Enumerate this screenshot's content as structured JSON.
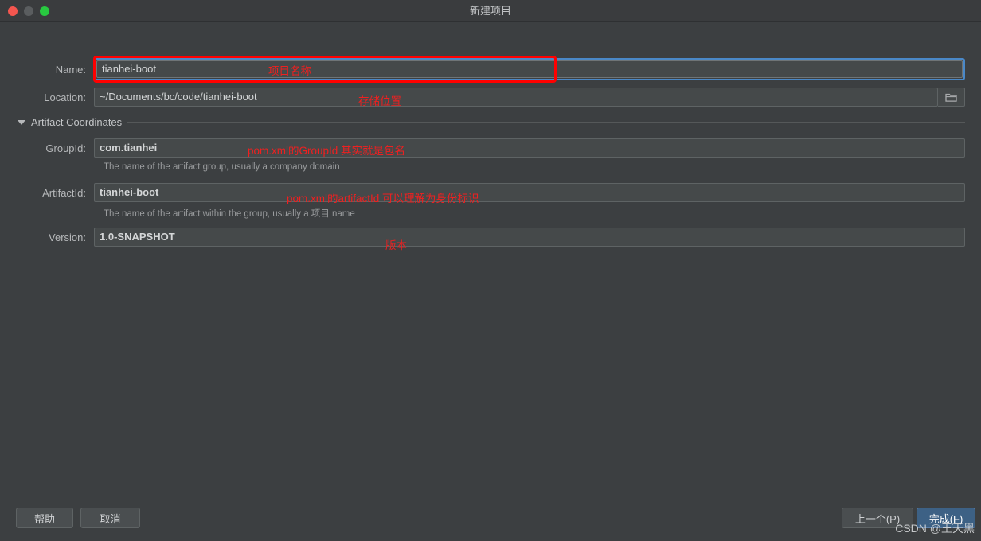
{
  "window": {
    "title": "新建项目",
    "traffic_lights": [
      "close",
      "minimize",
      "zoom"
    ]
  },
  "form": {
    "name": {
      "label": "Name:",
      "value": "tianhei-boot",
      "focused": true,
      "highlight_color": "#ff0000",
      "focus_color": "#4a88c7"
    },
    "location": {
      "label": "Location:",
      "value": "~/Documents/bc/code/tianhei-boot",
      "browse_icon": "folder-icon"
    },
    "artifact_section": {
      "label": "Artifact Coordinates",
      "expanded": true,
      "disclosure_icon": "triangle-down-icon"
    },
    "group_id": {
      "label": "GroupId:",
      "value": "com.tianhei",
      "hint": "The name of the artifact group, usually a company domain"
    },
    "artifact_id": {
      "label": "ArtifactId:",
      "value": "tianhei-boot",
      "hint": "The name of the artifact within the group, usually a 项目 name"
    },
    "version": {
      "label": "Version:",
      "value": "1.0-SNAPSHOT"
    }
  },
  "annotations": {
    "color": "#ef2020",
    "name": "项目名称",
    "location": "存储位置",
    "group_id": "pom.xml的GroupId 其实就是包名",
    "artifact_id": "pom.xml的artifactId 可以理解为身份标识",
    "version": "版本"
  },
  "footer": {
    "help": "帮助",
    "cancel": "取消",
    "previous": "上一个(P)",
    "finish": "完成(F)",
    "finish_color": "#3d6185"
  },
  "watermark": "CSDN @王天黑"
}
